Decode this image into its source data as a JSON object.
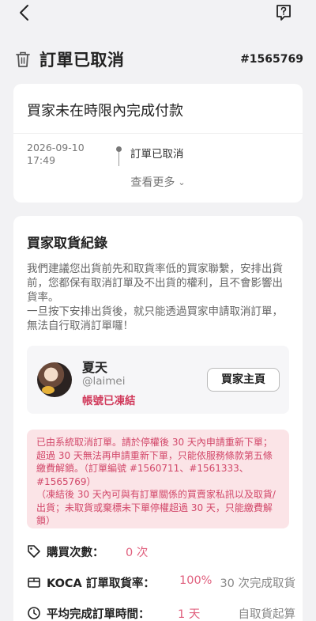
{
  "header": {
    "title": "訂單已取消",
    "order_number": "#1565769"
  },
  "cancel_card": {
    "reason": "買家未在時限內完成付款",
    "timeline": {
      "date": "2026-09-10",
      "time": "17:49",
      "status": "訂單已取消"
    },
    "more_label": "查看更多"
  },
  "buyer_section": {
    "title": "買家取貨紀錄",
    "desc_1": "我們建議您出貨前先和取貨率低的買家聯繫，安排出貨前，您都保有取消訂單及不出貨的權利，且不會影響出貨率。",
    "desc_2": "一旦按下安排出貨後，就只能透過買家申請取消訂單，無法自行取消訂單囉！",
    "buyer": {
      "name": "夏天",
      "handle": "@laimei",
      "status": "帳號已凍結",
      "profile_button": "買家主頁"
    },
    "warning": "已由系統取消訂單。請於停權後 30 天內申請重新下單；超過 30 天無法再申請重新下單，只能依服務條款第五條繳費解鎖。（訂單編號 #1560711、#1561333、#1565769）\n（凍結後 30 天內可與有訂單關係的買賣家私訊以及取貨/出貨；未取貨或棄標未下單停權超過 30 天，只能繳費解鎖）",
    "stats": {
      "purchases_label": "購買次數：",
      "purchases_value": "0 次",
      "pickup_label": "KOCA 訂單取貨率：",
      "pickup_value": "100%",
      "pickup_note": "30 次完成取貨",
      "avg_time_label": "平均完成訂單時間：",
      "avg_time_value": "1 天",
      "avg_time_note": "自取貨起算"
    }
  },
  "colors": {
    "accent": "#d13b5c",
    "warning_bg": "#fbe4e7",
    "page_bg": "#f2f2f4"
  }
}
